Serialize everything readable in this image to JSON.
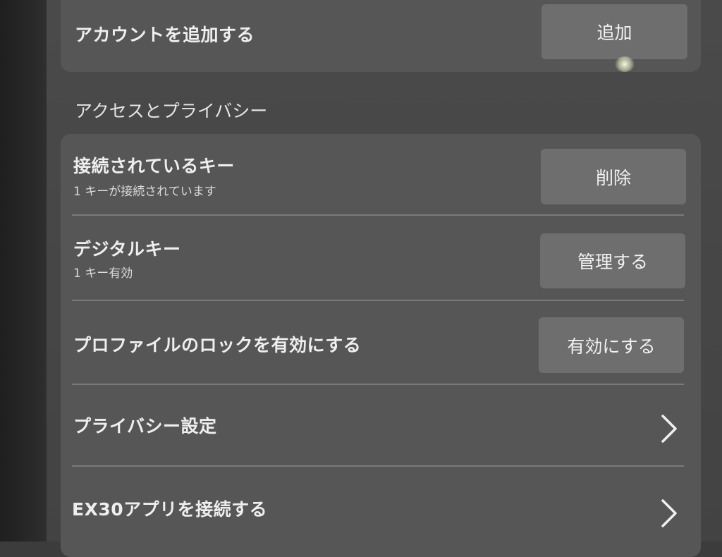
{
  "account": {
    "title": "アカウントを追加する",
    "button_label": "追加"
  },
  "section": {
    "label": "アクセスとプライバシー"
  },
  "rows": {
    "connected_keys": {
      "title": "接続されているキー",
      "subtitle": "1 キーが接続されています",
      "button_label": "削除"
    },
    "digital_key": {
      "title": "デジタルキー",
      "subtitle": "1 キー有効",
      "button_label": "管理する"
    },
    "profile_lock": {
      "title": "プロファイルのロックを有効にする",
      "button_label": "有効にする"
    },
    "privacy_settings": {
      "title": "プライバシー設定",
      "icon": "chevron-right-icon"
    },
    "ex30_app": {
      "title": "EX30アプリを接続する",
      "icon": "chevron-right-icon"
    }
  },
  "colors": {
    "background": "#474747",
    "card": "#565656",
    "button": "#6e6e6e",
    "text": "#eeeeee"
  }
}
